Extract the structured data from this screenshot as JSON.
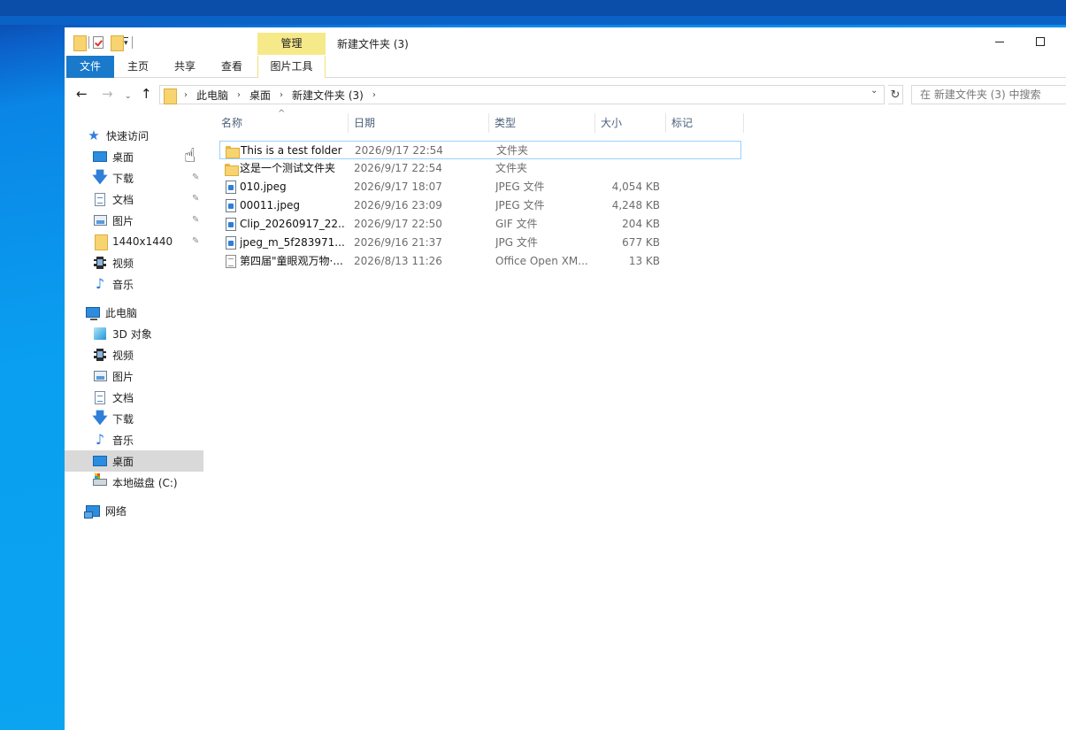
{
  "window": {
    "title": "新建文件夹 (3)",
    "context_tab_header": "管理"
  },
  "ribbon": {
    "tabs": [
      "文件",
      "主页",
      "共享",
      "查看",
      "图片工具"
    ]
  },
  "address": {
    "crumbs": [
      "此电脑",
      "桌面",
      "新建文件夹 (3)"
    ],
    "search_placeholder": "在 新建文件夹 (3) 中搜索"
  },
  "sidebar": {
    "quick_access": {
      "label": "快速访问",
      "items": [
        "桌面",
        "下载",
        "文档",
        "图片",
        "1440x1440",
        "视频",
        "音乐"
      ]
    },
    "this_pc": {
      "label": "此电脑",
      "items": [
        "3D 对象",
        "视频",
        "图片",
        "文档",
        "下载",
        "音乐",
        "桌面",
        "本地磁盘 (C:)"
      ]
    },
    "network": {
      "label": "网络"
    }
  },
  "columns": [
    "名称",
    "日期",
    "类型",
    "大小",
    "标记"
  ],
  "files": [
    {
      "name": "This is a test folder",
      "date": "2026/9/17 22:54",
      "type": "文件夹",
      "size": "",
      "icon": "folder-icon"
    },
    {
      "name": "这是一个测试文件夹",
      "date": "2026/9/17 22:54",
      "type": "文件夹",
      "size": "",
      "icon": "folder-icon"
    },
    {
      "name": "010.jpeg",
      "date": "2026/9/17 18:07",
      "type": "JPEG 文件",
      "size": "4,054 KB",
      "icon": "image-file-icon"
    },
    {
      "name": "00011.jpeg",
      "date": "2026/9/16 23:09",
      "type": "JPEG 文件",
      "size": "4,248 KB",
      "icon": "image-file-icon"
    },
    {
      "name": "Clip_20260917_22...",
      "date": "2026/9/17 22:50",
      "type": "GIF 文件",
      "size": "204 KB",
      "icon": "image-file-icon"
    },
    {
      "name": "jpeg_m_5f283971...",
      "date": "2026/9/16 21:37",
      "type": "JPG 文件",
      "size": "677 KB",
      "icon": "image-file-icon"
    },
    {
      "name": "第四届\"童眼观万物·...",
      "date": "2026/8/13 11:26",
      "type": "Office Open XM...",
      "size": "13 KB",
      "icon": "document-file-icon"
    }
  ]
}
